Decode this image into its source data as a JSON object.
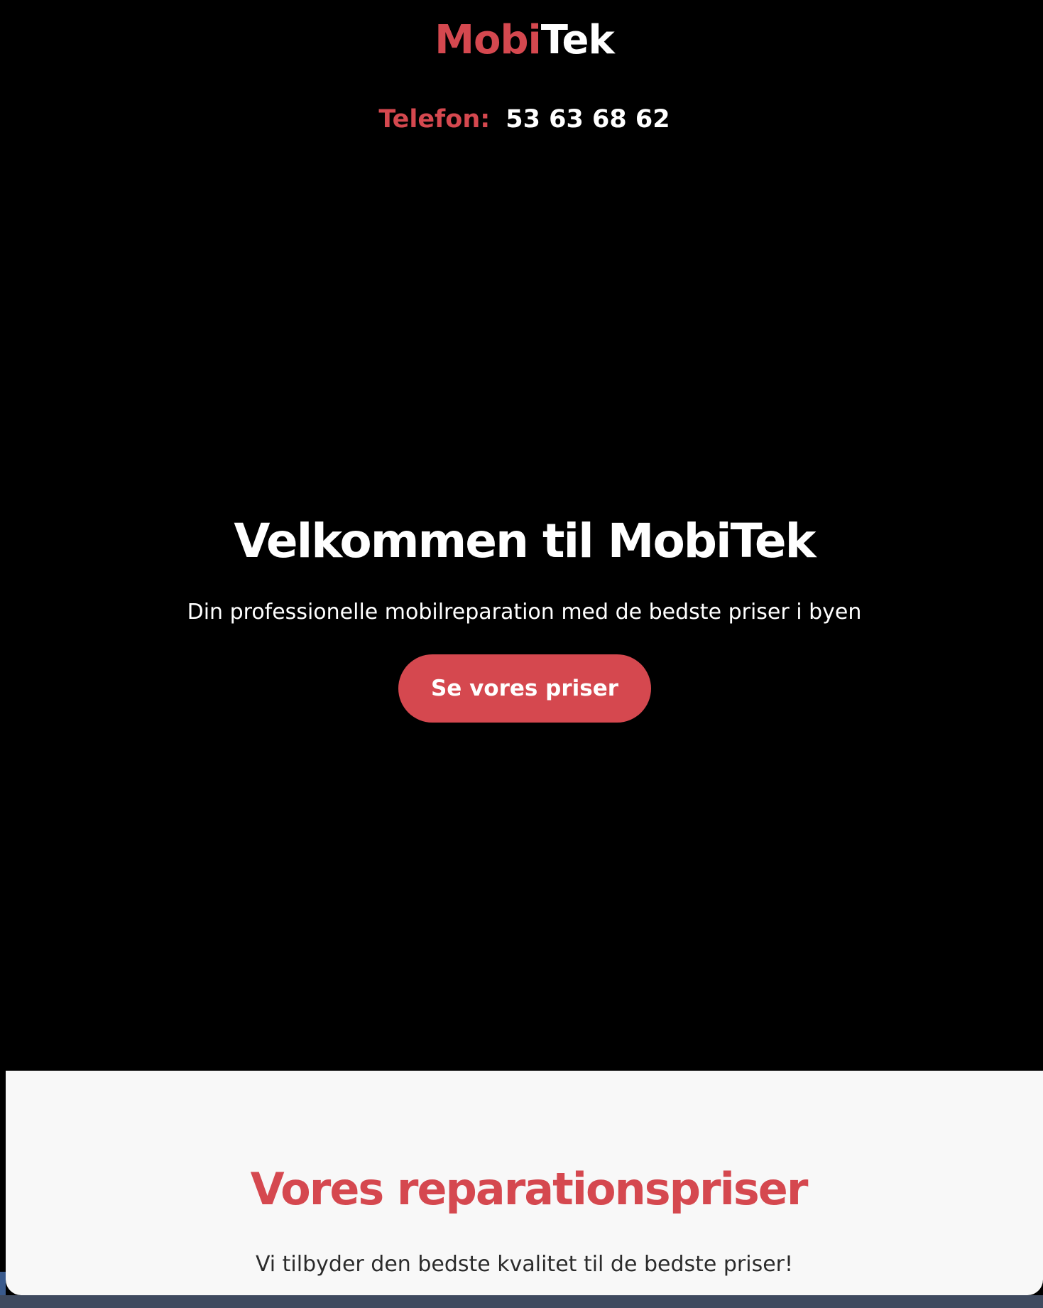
{
  "header": {
    "logo_accent": "Mobi",
    "logo_rest": "Tek",
    "phone_label": "Telefon:",
    "phone_number": "53 63 68 62"
  },
  "hero": {
    "title": "Velkommen til MobiTek",
    "subtitle": "Din professionelle mobilreparation med de bedste priser i byen",
    "cta_label": "Se vores priser"
  },
  "prices": {
    "title": "Vores reparationspriser",
    "subtitle": "Vi tilbyder den bedste kvalitet til de bedste priser!"
  },
  "colors": {
    "accent": "#d5484f",
    "hero_background": "#000000",
    "section_background": "#f8f8f8",
    "text_dark": "#2b2b2b"
  }
}
